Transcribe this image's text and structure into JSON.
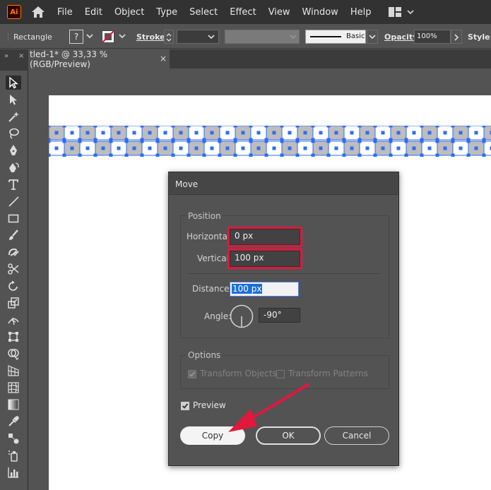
{
  "app": {
    "logo": "Ai"
  },
  "menu": [
    "File",
    "Edit",
    "Object",
    "Type",
    "Select",
    "Effect",
    "View",
    "Window",
    "Help"
  ],
  "control": {
    "shape_label": "Rectangle",
    "stroke_label": "Stroke:",
    "profile_label": "Basic",
    "opacity_label": "Opacity:",
    "opacity_value": "100%",
    "style_label": "Style:"
  },
  "document": {
    "tab_title": "tled-1* @ 33,33 % (RGB/Preview)",
    "close": "×"
  },
  "dialog": {
    "title": "Move",
    "position_group": "Position",
    "horizontal_label": "Horizontal:",
    "horizontal_value": "0 px",
    "vertical_label": "Vertical:",
    "vertical_value": "100 px",
    "distance_label": "Distance:",
    "distance_value": "100 px",
    "angle_label": "Angle:",
    "angle_value": "-90°",
    "options_group": "Options",
    "transform_objects": "Transform Objects",
    "transform_patterns": "Transform Patterns",
    "preview_label": "Preview",
    "copy_button": "Copy",
    "ok_button": "OK",
    "cancel_button": "Cancel"
  },
  "colors": {
    "accent_red": "#e1173c",
    "selection_blue": "#2e6cf5",
    "tile_gray": "#bdbdbd"
  }
}
